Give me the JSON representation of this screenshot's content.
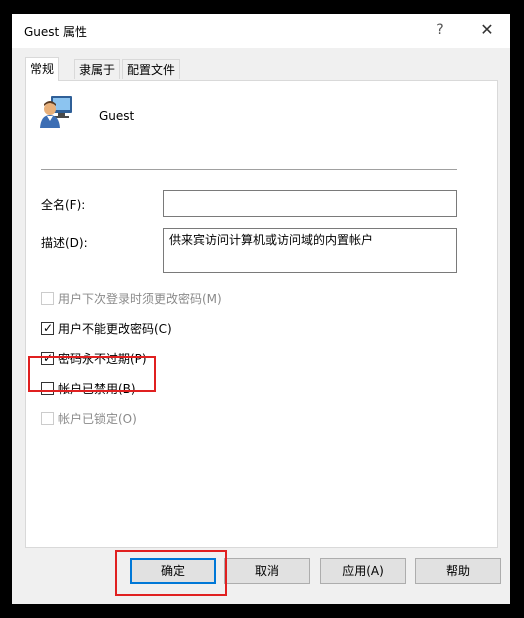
{
  "window": {
    "title": "Guest 属性",
    "help_glyph": "?",
    "close_glyph": "✕"
  },
  "tabs": [
    {
      "label": "常规",
      "active": true
    },
    {
      "label": "隶属于",
      "active": false
    },
    {
      "label": "配置文件",
      "active": false
    }
  ],
  "user": {
    "name": "Guest",
    "icon": "user-account-icon"
  },
  "fields": {
    "fullname_label": "全名(F):",
    "fullname_value": "",
    "description_label": "描述(D):",
    "description_value": "供来宾访问计算机或访问域的内置帐户"
  },
  "checkboxes": [
    {
      "label": "用户下次登录时须更改密码(M)",
      "checked": false,
      "enabled": false
    },
    {
      "label": "用户不能更改密码(C)",
      "checked": true,
      "enabled": true
    },
    {
      "label": "密码永不过期(P)",
      "checked": true,
      "enabled": true
    },
    {
      "label": "帐户已禁用(B)",
      "checked": false,
      "enabled": true
    },
    {
      "label": "帐户已锁定(O)",
      "checked": false,
      "enabled": false
    }
  ],
  "buttons": {
    "ok": "确定",
    "cancel": "取消",
    "apply": "应用(A)",
    "help": "帮助"
  },
  "colors": {
    "highlight": "#e02020",
    "focus": "#0078d7"
  }
}
